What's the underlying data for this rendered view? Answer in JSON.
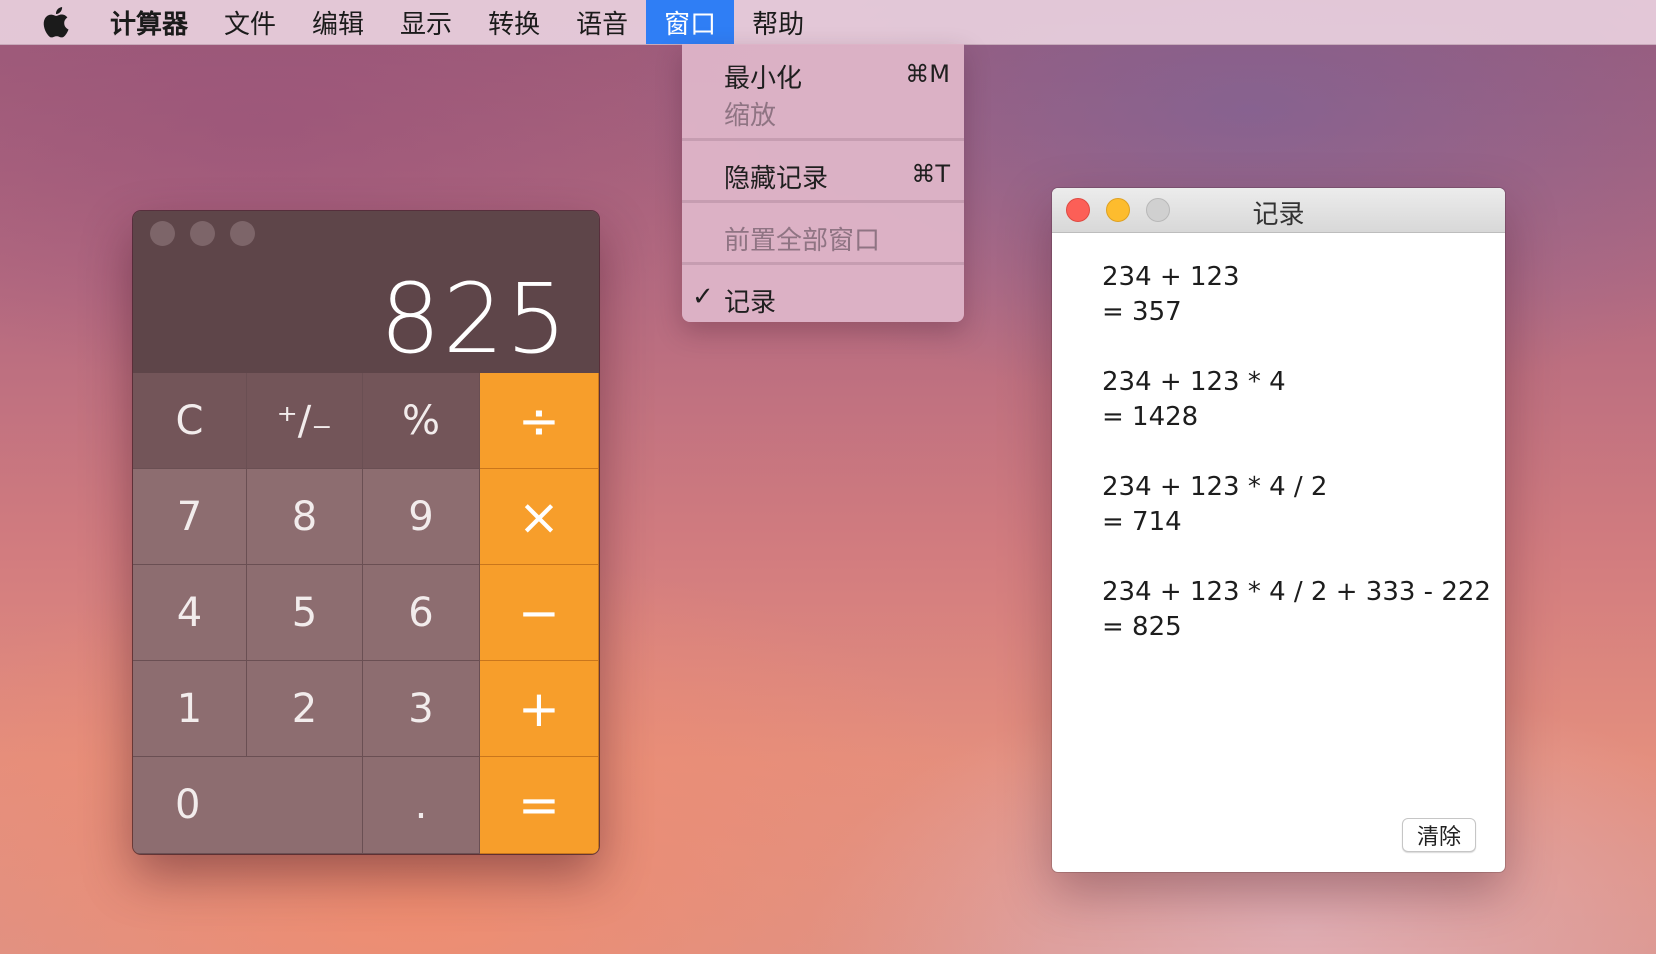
{
  "menubar": {
    "apple_icon": "apple-logo-icon",
    "items": [
      "计算器",
      "文件",
      "编辑",
      "显示",
      "转换",
      "语音",
      "窗口",
      "帮助"
    ],
    "active_item": "窗口"
  },
  "window_menu": {
    "items": [
      {
        "label": "最小化",
        "shortcut": "⌘M",
        "enabled": true
      },
      {
        "label": "缩放",
        "shortcut": "",
        "enabled": false
      },
      {
        "label": "隐藏记录",
        "shortcut": "⌘T",
        "enabled": true
      },
      {
        "label": "前置全部窗口",
        "shortcut": "",
        "enabled": false
      },
      {
        "label": "记录",
        "shortcut": "",
        "enabled": true,
        "checked": true,
        "check_icon": "✓"
      }
    ]
  },
  "calculator": {
    "display": "825",
    "keys": {
      "clear": "C",
      "sign": "⁺∕₋",
      "percent": "%",
      "divide": "÷",
      "seven": "7",
      "eight": "8",
      "nine": "9",
      "multiply": "×",
      "four": "4",
      "five": "5",
      "six": "6",
      "minus": "−",
      "one": "1",
      "two": "2",
      "three": "3",
      "plus": "+",
      "zero": "0",
      "decimal": ".",
      "equals": "="
    }
  },
  "history": {
    "title": "记录",
    "entries": [
      {
        "expr": "234 + 123",
        "result": "= 357"
      },
      {
        "expr": "234 + 123 * 4",
        "result": "= 1428"
      },
      {
        "expr": "234 + 123 * 4 / 2",
        "result": "= 714"
      },
      {
        "expr": "234 + 123 * 4 / 2 + 333 - 222",
        "result": "= 825"
      }
    ],
    "clear_label": "清除"
  },
  "colors": {
    "menu_highlight": "#2f7ef5",
    "operator_key": "#f79e2b",
    "display_bg": "#5e4549"
  }
}
